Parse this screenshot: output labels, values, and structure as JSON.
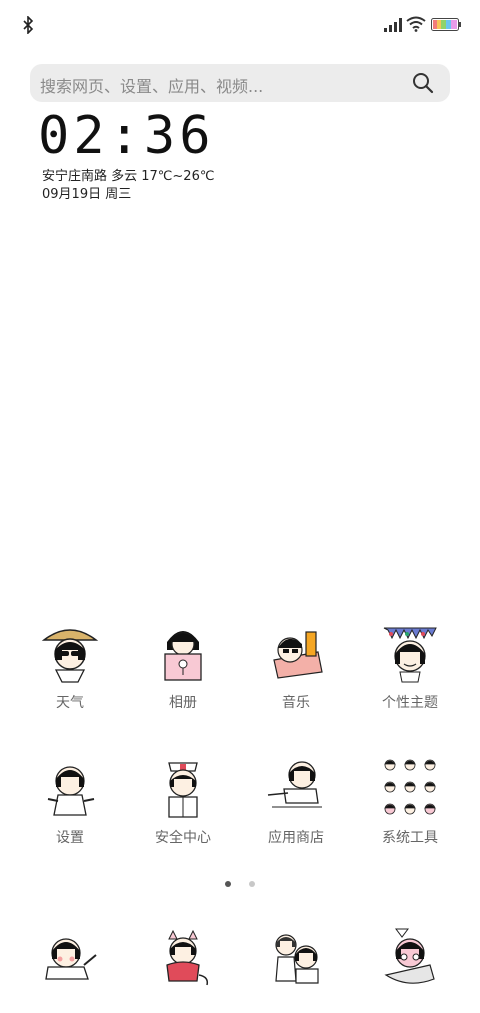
{
  "search": {
    "placeholder": "搜索网页、设置、应用、视频..."
  },
  "clock": {
    "time": "02:36",
    "location_weather": "安宁庄南路  多云  17℃~26℃",
    "date": "09月19日 周三"
  },
  "apps": [
    {
      "label": "天气",
      "icon": "weather-icon"
    },
    {
      "label": "相册",
      "icon": "gallery-icon"
    },
    {
      "label": "音乐",
      "icon": "music-icon"
    },
    {
      "label": "个性主题",
      "icon": "themes-icon"
    },
    {
      "label": "设置",
      "icon": "settings-icon"
    },
    {
      "label": "安全中心",
      "icon": "security-icon"
    },
    {
      "label": "应用商店",
      "icon": "app-store-icon"
    },
    {
      "label": "系统工具",
      "icon": "system-tools-icon"
    }
  ],
  "pages": {
    "total": 2,
    "current": 1
  },
  "dock": [
    {
      "icon": "phone-icon"
    },
    {
      "icon": "messages-icon"
    },
    {
      "icon": "browser-icon"
    },
    {
      "icon": "camera-icon"
    }
  ],
  "colors": {
    "search_bg": "#ececec",
    "dot_active": "#555555",
    "dot_inactive": "#c8c8c8"
  }
}
